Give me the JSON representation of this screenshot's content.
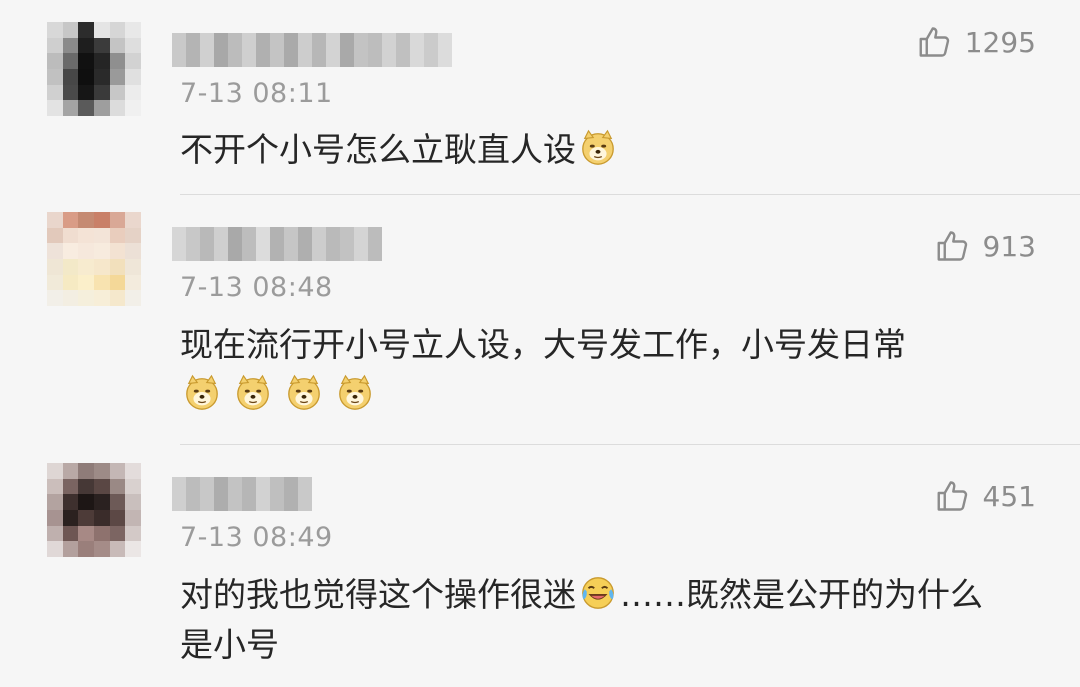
{
  "comments": [
    {
      "timestamp": "7-13 08:11",
      "likes": "1295",
      "text_before": "不开个小号怎么立耿直人设",
      "text_after": "",
      "emoji": [
        "doge-emoji"
      ]
    },
    {
      "timestamp": "7-13 08:48",
      "likes": "913",
      "text_before": "现在流行开小号立人设，大号发工作，小号发日常",
      "text_after": "",
      "emoji": [
        "doge-emoji",
        "doge-emoji",
        "doge-emoji",
        "doge-emoji"
      ]
    },
    {
      "timestamp": "7-13 08:49",
      "likes": "451",
      "text_before": "对的我也觉得这个操作很迷",
      "text_after": "……既然是公开的为什么是小号",
      "emoji": [
        "laugh-cry-emoji"
      ]
    }
  ],
  "icons": {
    "like": "thumbs-up-outline-icon"
  },
  "colors": {
    "background": "#f6f6f6",
    "timestamp": "#9b9b9b",
    "like_count": "#8c8c8c",
    "divider": "#dcdcdc",
    "emoji_face": "#f4d06f"
  }
}
